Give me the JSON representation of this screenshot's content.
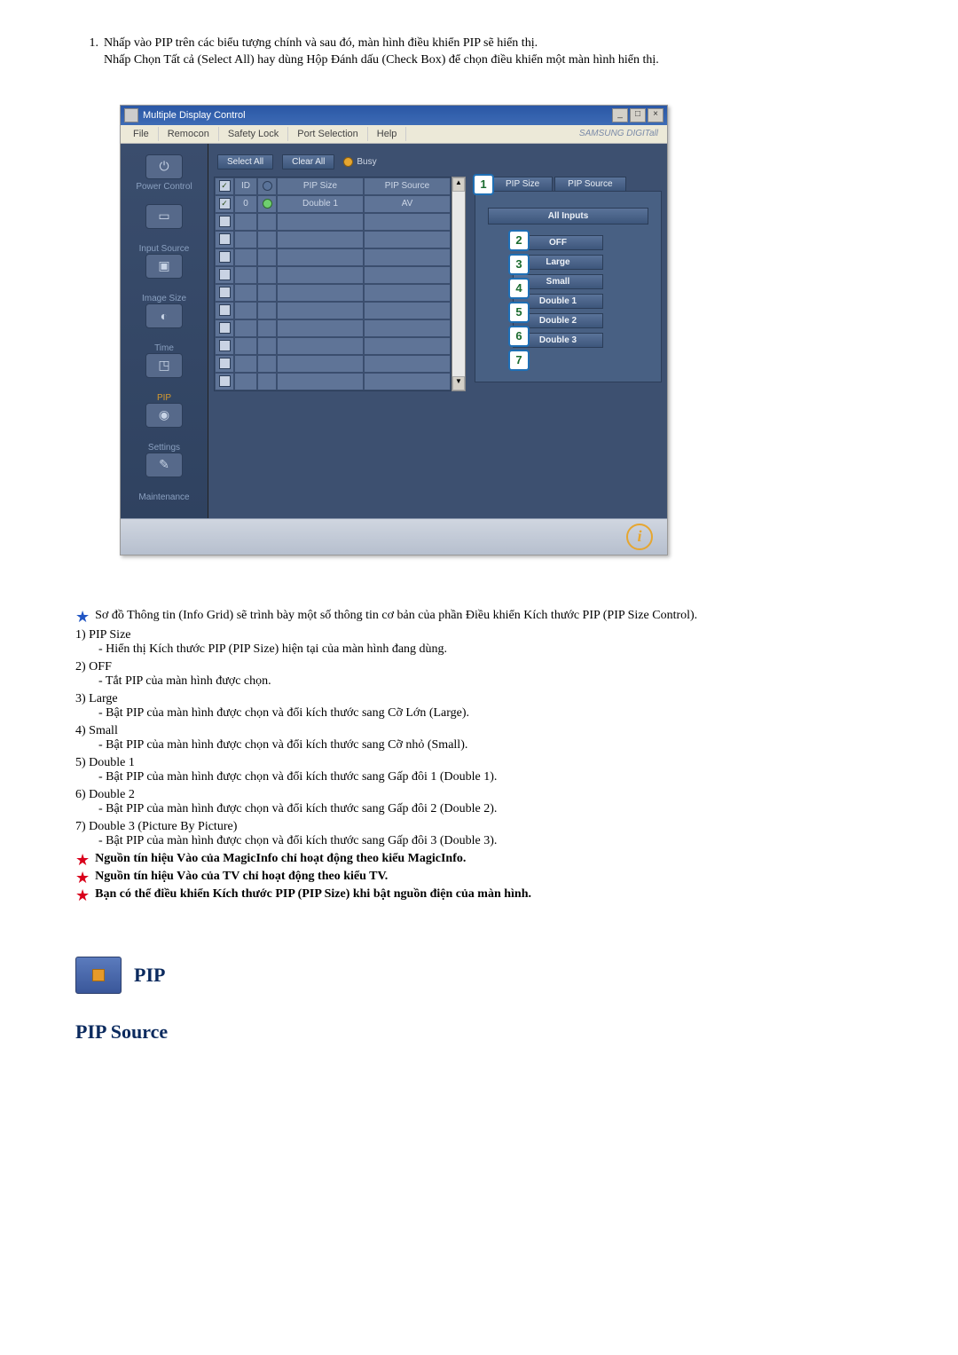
{
  "instructions": {
    "num": "1.",
    "line1": "Nhấp vào PIP trên các biểu tượng chính và sau đó, màn hình điều khiển PIP sẽ hiển thị.",
    "line2": "Nhấp Chọn Tất cả (Select All) hay dùng Hộp Đánh dấu (Check Box) để chọn điều khiển một màn hình hiển thị."
  },
  "window": {
    "title": "Multiple Display Control",
    "menubar": [
      "File",
      "Remocon",
      "Safety Lock",
      "Port Selection",
      "Help"
    ],
    "brand": "SAMSUNG DIGITall",
    "sidebar": [
      {
        "label": "Power Control"
      },
      {
        "label": ""
      },
      {
        "label": "Input Source"
      },
      {
        "label": "Image Size"
      },
      {
        "label": "Time"
      },
      {
        "label": "PIP"
      },
      {
        "label": "Settings"
      },
      {
        "label": "Maintenance"
      }
    ],
    "toolbar": {
      "select_all": "Select All",
      "clear_all": "Clear All",
      "busy": "Busy"
    },
    "grid": {
      "headers": {
        "chk": "✓",
        "id": "ID",
        "status": "",
        "size": "PIP Size",
        "source": "PIP Source"
      },
      "rows": [
        {
          "checked": true,
          "id": "0",
          "status": true,
          "size": "Double 1",
          "source": "AV"
        },
        {
          "checked": false
        },
        {
          "checked": false
        },
        {
          "checked": false
        },
        {
          "checked": false
        },
        {
          "checked": false
        },
        {
          "checked": false
        },
        {
          "checked": false
        },
        {
          "checked": false
        },
        {
          "checked": false
        },
        {
          "checked": false
        }
      ]
    },
    "tabs": {
      "size": "PIP Size",
      "source": "PIP Source"
    },
    "all_inputs": "All Inputs",
    "options": [
      "OFF",
      "Large",
      "Small",
      "Double 1",
      "Double 2",
      "Double 3"
    ]
  },
  "callouts": [
    "1",
    "2",
    "3",
    "4",
    "5",
    "6",
    "7"
  ],
  "desc": {
    "intro": "Sơ đồ Thông tin (Info Grid) sẽ trình bày một số thông tin cơ bản của phần Điều khiển Kích thước PIP (PIP Size Control).",
    "items": [
      {
        "n": "1)",
        "t": "PIP Size",
        "d": "- Hiển thị Kích thước PIP (PIP Size) hiện tại của màn hình đang dùng."
      },
      {
        "n": "2)",
        "t": "OFF",
        "d": "- Tắt PIP của màn hình được chọn."
      },
      {
        "n": "3)",
        "t": "Large",
        "d": "- Bật PIP của màn hình được chọn và đổi kích thước sang Cỡ Lớn (Large)."
      },
      {
        "n": "4)",
        "t": "Small",
        "d": "- Bật PIP của màn hình được chọn và đổi kích thước sang Cỡ nhỏ (Small)."
      },
      {
        "n": "5)",
        "t": "Double 1",
        "d": "- Bật PIP của màn hình được chọn và đổi kích thước sang Gấp đôi 1 (Double 1)."
      },
      {
        "n": "6)",
        "t": "Double 2",
        "d": "- Bật PIP của màn hình được chọn và đổi kích thước sang Gấp đôi 2 (Double 2)."
      },
      {
        "n": "7)",
        "t": "Double 3 (Picture By Picture)",
        "d": "- Bật PIP của màn hình được chọn và đổi kích thước sang Gấp đôi 3 (Double 3)."
      }
    ],
    "notes": [
      "Nguồn tín hiệu Vào của MagicInfo chỉ hoạt động theo kiểu MagicInfo.",
      "Nguồn tín hiệu Vào của TV chỉ hoạt động theo kiểu TV.",
      "Bạn có thể điều khiển Kích thước PIP (PIP Size) khi bật nguồn điện của màn hình."
    ]
  },
  "heading": {
    "pip": "PIP",
    "source": "PIP Source"
  }
}
